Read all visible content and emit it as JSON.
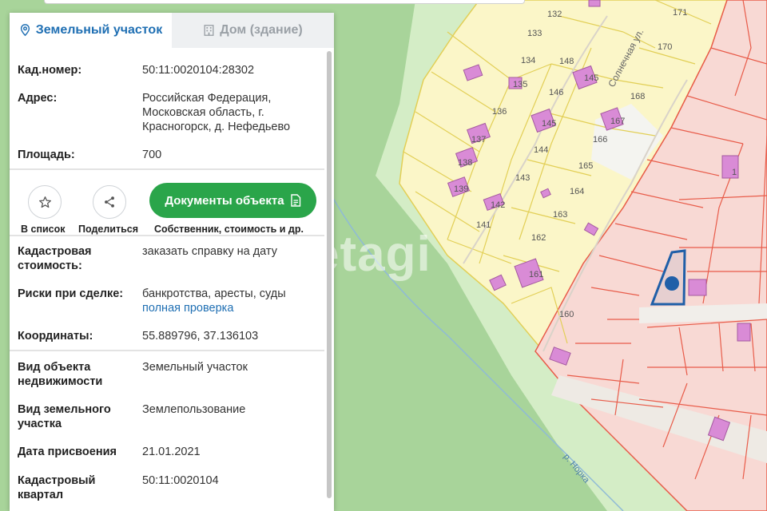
{
  "map": {
    "watermark": "etagi",
    "street_label": "Солнечная ул.",
    "river_label": "р. Норка",
    "parcel_numbers": [
      "132",
      "133",
      "134",
      "135",
      "136",
      "137",
      "138",
      "139",
      "140",
      "141",
      "142",
      "143",
      "144",
      "145",
      "146",
      "147",
      "148",
      "160",
      "161",
      "162",
      "163",
      "164",
      "165",
      "166",
      "167",
      "168",
      "170",
      "171",
      "1"
    ]
  },
  "tabs": [
    {
      "label": "Земельный участок",
      "icon": "location-pin-icon",
      "active": true
    },
    {
      "label": "Дом (здание)",
      "icon": "building-icon",
      "active": false
    }
  ],
  "details": {
    "cad_number_label": "Кад.номер:",
    "cad_number_value": "50:11:0020104:28302",
    "address_label": "Адрес:",
    "address_value": "Российская Федерация, Московская область, г. Красногорск, д. Нефедьево",
    "area_label": "Площадь:",
    "area_value": "700"
  },
  "actions": {
    "favorite_label": "В список",
    "share_label": "Поделиться",
    "docs_button": "Документы объекта",
    "docs_caption": "Собственник, стоимость и др."
  },
  "extra": {
    "cad_cost_label": "Кадастровая стоимость:",
    "cad_cost_link": "заказать справку на дату",
    "risks_label": "Риски при сделке:",
    "risks_value": "банкротства, аресты, суды",
    "risks_link": "полная проверка",
    "coords_label": "Координаты:",
    "coords_value": "55.889796, 37.136103"
  },
  "more": {
    "object_type_label": "Вид объекта недвижимости",
    "object_type_value": "Земельный участок",
    "land_type_label": "Вид земельного участка",
    "land_type_value": "Землепользование",
    "date_label": "Дата присвоения",
    "date_value": "21.01.2021",
    "quarter_label": "Кадастровый квартал",
    "quarter_value": "50:11:0020104"
  },
  "colors": {
    "accent": "#1f6fb3",
    "green_button": "#2aa54a",
    "map_green": "#a8d49a",
    "yellow_zone": "#fbf6c8",
    "pink_zone": "#f8d9d4",
    "building": "#d98bd6",
    "marker": "#1f5fa8"
  }
}
